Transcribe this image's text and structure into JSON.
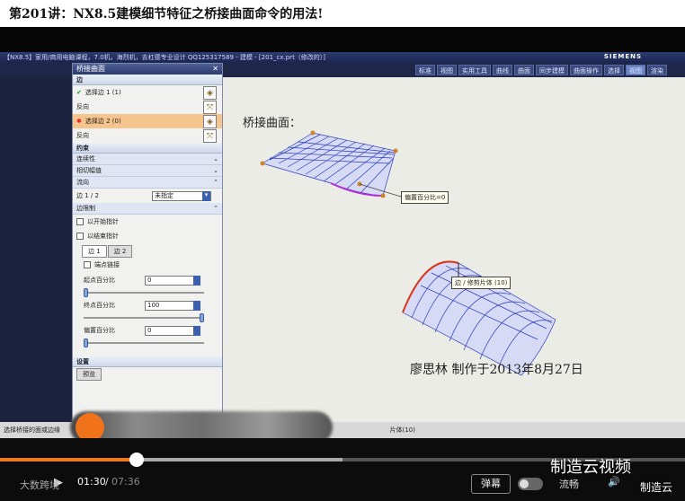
{
  "page_title": "第201讲：NX8.5建模细节特征之桥接曲面命令的用法!",
  "nx": {
    "window_title": "【NX8.5】家用/商用电脑课程，7.0机，海烈机，去杠德专业设计 QQ125317589 - 建模 - [201_cx.prt（修改的）]",
    "brand": "SIEMENS",
    "toolbar_buttons": [
      "标准",
      "视图",
      "实用工具",
      "曲线",
      "曲面",
      "同步建模",
      "曲面操作",
      "选择",
      "视图",
      "渲染"
    ],
    "status_left": "选择桥接的面或边缘",
    "status_right": "片体(10)"
  },
  "dialog": {
    "title": "桥接曲面",
    "section_edges": "边",
    "select_edge1": "选择边 1 (1)",
    "reverse1": "反向",
    "select_edge2": "选择边 2 (0)",
    "reverse2": "反向",
    "section_constraints": "约束",
    "continuity": "连续性",
    "tangent_magnitude": "相切幅值",
    "flow": "流向",
    "flow_edge_label": "边 1 / 2",
    "flow_value": "未指定",
    "section_edge_limits": "边限制",
    "opt_start": "以开始指针",
    "opt_end": "以结束指针",
    "tab1": "边 1",
    "tab2": "边 2",
    "link_ends": "端点链接",
    "start_percent_label": "起点百分比",
    "start_percent": "0",
    "end_percent_label": "终点百分比",
    "end_percent": "100",
    "offset_percent_label": "偏置百分比",
    "offset_percent": "0",
    "section_settings": "设置",
    "preview": "预览"
  },
  "canvas": {
    "heading": "桥接曲面：",
    "callout1": "偏置百分比=0",
    "callout2": "边 / 修剪片体 (10)",
    "footer": "廖思林  制作于2013年8月27日"
  },
  "player": {
    "current_time": "01:30",
    "total_time": "07:36",
    "progress": 0.2,
    "buffered": 0.5,
    "danmu": "弹幕",
    "quality": "流畅",
    "brand_left": "大数跨境",
    "watermark_main": "制造云视频",
    "watermark_small": "制造云"
  },
  "colors": {
    "played": "#f07a1f",
    "surface_grid": "#2a3db8",
    "bridge_edge": "#d9361b"
  }
}
